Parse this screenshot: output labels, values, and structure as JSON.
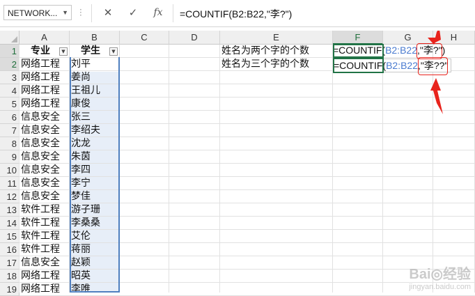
{
  "formula_bar": {
    "name_box": "NETWORK...",
    "cancel_icon": "✕",
    "enter_icon": "✓",
    "fx_label": "fx",
    "formula": "=COUNTIF(B2:B22,\"李?\")"
  },
  "columns": [
    "A",
    "B",
    "C",
    "D",
    "E",
    "F",
    "G",
    "H"
  ],
  "selected_column": "F",
  "rows": [
    "1",
    "2",
    "3",
    "4",
    "5",
    "6",
    "7",
    "8",
    "9",
    "10",
    "11",
    "12",
    "13",
    "14",
    "15",
    "16",
    "17",
    "18",
    "19"
  ],
  "selected_rows": [
    "1",
    "2"
  ],
  "table": {
    "headers": [
      "专业",
      "学生"
    ],
    "data": [
      [
        "网络工程",
        "刘平"
      ],
      [
        "网络工程",
        "姜尚"
      ],
      [
        "网络工程",
        "王祖儿"
      ],
      [
        "网络工程",
        "康俊"
      ],
      [
        "信息安全",
        "张三"
      ],
      [
        "信息安全",
        "李绍夫"
      ],
      [
        "信息安全",
        "沈龙"
      ],
      [
        "信息安全",
        "朱茵"
      ],
      [
        "信息安全",
        "李四"
      ],
      [
        "信息安全",
        "李宁"
      ],
      [
        "信息安全",
        "梦佳"
      ],
      [
        "软件工程",
        "游子珊"
      ],
      [
        "软件工程",
        "李桑桑"
      ],
      [
        "软件工程",
        "艾伦"
      ],
      [
        "软件工程",
        "蒋丽"
      ],
      [
        "信息安全",
        "赵颖"
      ],
      [
        "网络工程",
        "昭英"
      ],
      [
        "网络工程",
        "李唯"
      ]
    ]
  },
  "labels": {
    "e1": "姓名为两个字的个数",
    "e2": "姓名为三个字的个数"
  },
  "edits": {
    "f1": {
      "fn": "=COUNTIF(",
      "ref": "B2:B22",
      "comma": ",",
      "crit": "\"李?\"",
      "close": ")"
    },
    "f2": {
      "fn": "=COUNTIF(",
      "ref": "B2:B22",
      "comma": ",",
      "crit": "\"李??\"",
      "close": ""
    }
  },
  "colors": {
    "accent_green": "#217346",
    "selection_blue": "#4f7fbf",
    "ref_blue": "#4a7bd0",
    "annotation_red": "#e8231c"
  },
  "watermark": {
    "main": "Bai◎经验",
    "sub": "jingyan.baidu.com"
  }
}
